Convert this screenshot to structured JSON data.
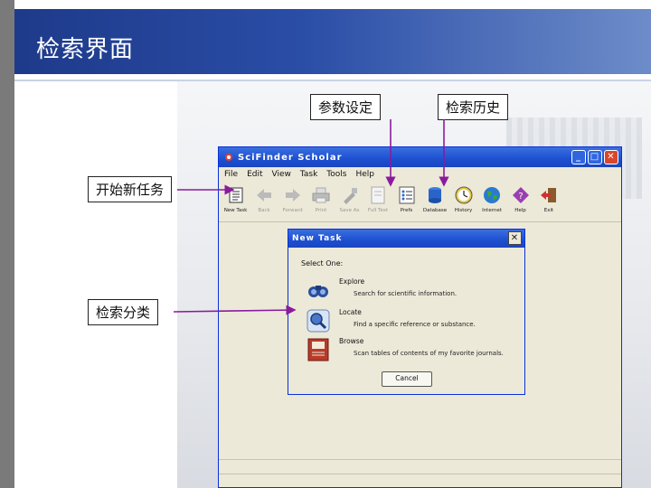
{
  "slide": {
    "title": "检索界面",
    "callouts": {
      "params": "参数设定",
      "history": "检索历史",
      "new_task": "开始新任务",
      "classify": "检索分类"
    }
  },
  "window": {
    "title": "SciFinder Scholar",
    "menu": [
      "File",
      "Edit",
      "View",
      "Task",
      "Tools",
      "Help"
    ],
    "toolbar": [
      {
        "label": "New Task",
        "icon": "new-task-icon",
        "enabled": true
      },
      {
        "label": "Back",
        "icon": "back-arrow-icon",
        "enabled": false
      },
      {
        "label": "Forward",
        "icon": "forward-arrow-icon",
        "enabled": false
      },
      {
        "label": "Print",
        "icon": "printer-icon",
        "enabled": false
      },
      {
        "label": "Save As",
        "icon": "save-as-icon",
        "enabled": false
      },
      {
        "label": "Full Text",
        "icon": "full-text-icon",
        "enabled": false
      },
      {
        "label": "Prefs",
        "icon": "preferences-icon",
        "enabled": true
      },
      {
        "label": "Database",
        "icon": "database-icon",
        "enabled": true
      },
      {
        "label": "History",
        "icon": "history-clock-icon",
        "enabled": true
      },
      {
        "label": "Internet",
        "icon": "globe-icon",
        "enabled": true
      },
      {
        "label": "Help",
        "icon": "help-icon",
        "enabled": true
      },
      {
        "label": "Exit",
        "icon": "exit-icon",
        "enabled": true
      }
    ]
  },
  "dialog": {
    "title": "New Task",
    "heading": "Select One:",
    "options": [
      {
        "name": "Explore",
        "desc": "Search for scientific information.",
        "icon": "binoculars-icon"
      },
      {
        "name": "Locate",
        "desc": "Find a specific reference or substance.",
        "icon": "magnifier-icon"
      },
      {
        "name": "Browse",
        "desc": "Scan tables of contents of my favorite journals.",
        "icon": "journal-icon"
      }
    ],
    "cancel_label": "Cancel"
  },
  "colors": {
    "header_band": "#1e3a8a",
    "titlebar": "#1d4fd0",
    "window_bg": "#ece9d8",
    "arrow": "#8b1a9e"
  }
}
